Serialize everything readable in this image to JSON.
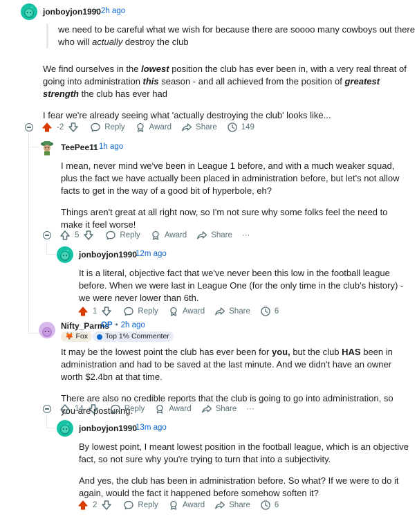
{
  "comments": [
    {
      "user": "jonboyjon1990",
      "time": "2h ago",
      "quote": "we need to be careful what we wish for because there are soooo many cowboys out there who will actually destroy the club",
      "quote_parts": [
        "we need to be careful what we wish for because there are soooo many cowboys out there who will ",
        "actually",
        " destroy the club"
      ],
      "para1_parts": [
        "We find ourselves in the ",
        "lowest",
        " position the club has ever been in, with a very real threat of going into administration ",
        "this",
        " season - and all achieved from the position of ",
        "greatest strength",
        " the club has ever had"
      ],
      "para2": "I fear we're already seeing what 'actually destroying the club' looks like...",
      "votes": "-2",
      "awards_count": "149"
    },
    {
      "user": "TeePee11",
      "time": "1h ago",
      "para1": "I mean, never mind we've been in League 1 before, and with a much weaker squad, plus the fact we have actually been placed in administration before, but let's not allow facts to get in the way of a good bit of hyperbole, eh?",
      "para2": "Things aren't great at all right now, so I'm not sure why some folks feel the need to make it feel worse!",
      "votes": "5"
    },
    {
      "user": "jonboyjon1990",
      "time": "12m ago",
      "para1": "It is a literal, objective fact that we've never been this low in the football league before. When we were last in League One (for the only time in the club's history) - we were never lower than 6th.",
      "votes": "1",
      "awards_count": "6"
    },
    {
      "user": "Nifty_Parms",
      "op": "OP",
      "time": "2h ago",
      "flair1": "Fox",
      "flair2": "Top 1% Commenter",
      "para1_parts": [
        "It may be the lowest point the club has ever been for ",
        "you,",
        " but the club ",
        "HAS",
        " been in administration and had to be saved at the last minute. And we didn't have an owner worth $2.4bn at that time."
      ],
      "para2": "There are also no credible reports that the club is going to go into administration, so you are posturing.",
      "votes": "14"
    },
    {
      "user": "jonboyjon1990",
      "time": "13m ago",
      "para1": "By lowest point, I meant lowest position in the football league, which is an objective fact, so not sure why you're trying to turn that into a subjectivity.",
      "para2": "And yes, the club has been in administration before. So what? If we were to do it again, would the fact it happened before somehow soften it?",
      "votes": "2",
      "awards_count": "6"
    }
  ],
  "actions": {
    "reply": "Reply",
    "award": "Award",
    "share": "Share",
    "more": "···"
  },
  "separator": "•",
  "colors": {
    "upvoted": "#d93a00",
    "meta": "#576f76",
    "time": "#0a66d0",
    "avatar_green": "#15c2a3"
  }
}
